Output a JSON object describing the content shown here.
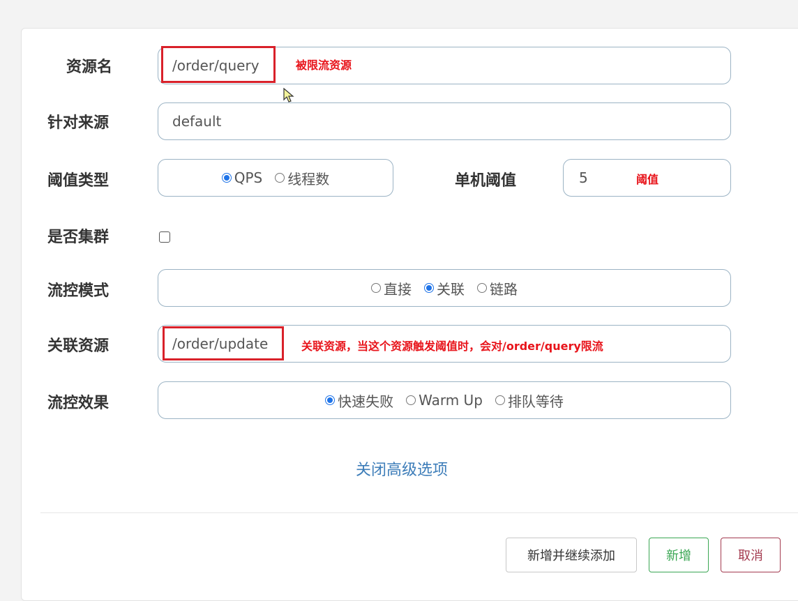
{
  "form": {
    "resource_name": {
      "label": "资源名",
      "value": "/order/query",
      "annotation": "被限流资源"
    },
    "limit_app": {
      "label": "针对来源",
      "value": "default"
    },
    "grade": {
      "label": "阈值类型",
      "options": [
        {
          "label": "QPS",
          "checked": true
        },
        {
          "label": "线程数",
          "checked": false
        }
      ]
    },
    "threshold": {
      "label": "单机阈值",
      "value": "5",
      "annotation": "阈值"
    },
    "cluster": {
      "label": "是否集群",
      "checked": false
    },
    "strategy": {
      "label": "流控模式",
      "options": [
        {
          "label": "直接",
          "checked": false
        },
        {
          "label": "关联",
          "checked": true
        },
        {
          "label": "链路",
          "checked": false
        }
      ]
    },
    "ref_resource": {
      "label": "关联资源",
      "value": "/order/update",
      "annotation": "关联资源，当这个资源触发阈值时，会对/order/query限流"
    },
    "control_behavior": {
      "label": "流控效果",
      "options": [
        {
          "label": "快速失败",
          "checked": true
        },
        {
          "label": "Warm Up",
          "checked": false
        },
        {
          "label": "排队等待",
          "checked": false
        }
      ]
    },
    "advanced_toggle": "关闭高级选项"
  },
  "footer": {
    "add_continue_label": "新增并继续添加",
    "add_label": "新增",
    "cancel_label": "取消"
  },
  "colors": {
    "accent": "#1e73e8",
    "annotation": "#e8141b",
    "link": "#3d7db9",
    "add_button": "#3aa653",
    "cancel_button": "#a33a4f"
  }
}
